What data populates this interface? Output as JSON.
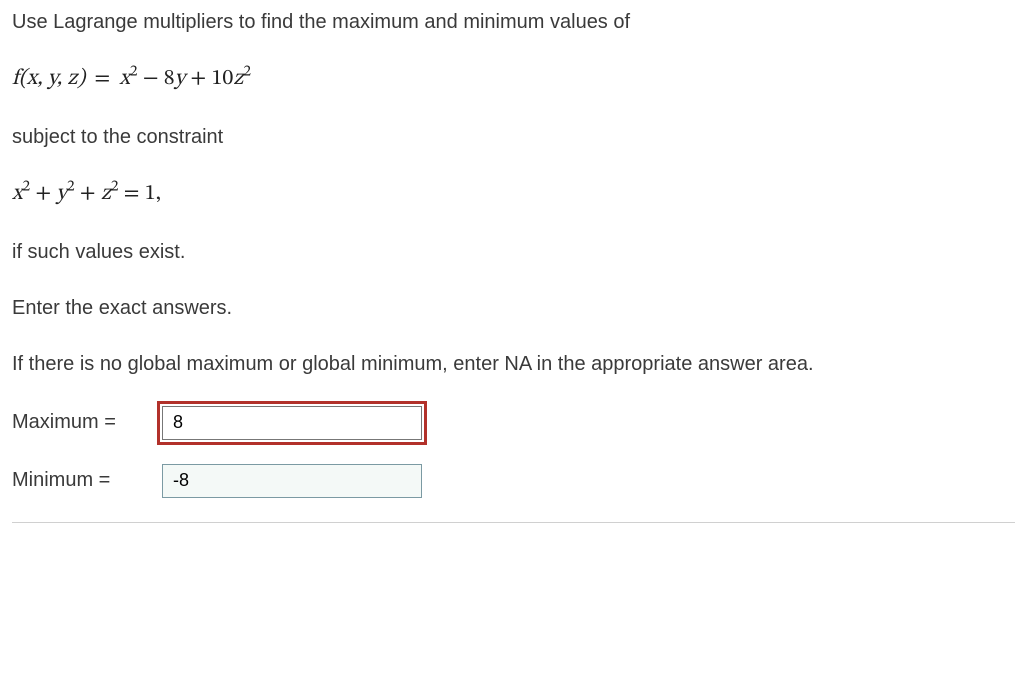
{
  "intro": "Use Lagrange multipliers to find the maximum and minimum values of",
  "func_lhs": "f(x, y, z)",
  "func_sep": "=",
  "func_rhs_plain": "x² − 8y + 10z²",
  "subject": "subject to the constraint",
  "constraint_plain": "x² + y² + z² = 1,",
  "ifvalues": "if such values exist.",
  "enter": "Enter the exact answers.",
  "na_note": "If there is no global maximum or global minimum, enter NA in the appropriate answer area.",
  "max_label": "Maximum  =",
  "min_label": "Minimum  =",
  "max_value": "8",
  "min_value": "-8"
}
